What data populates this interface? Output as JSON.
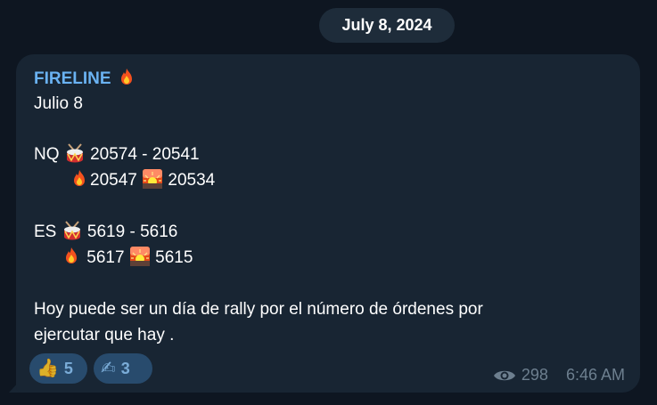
{
  "date_label": "July 8, 2024",
  "message": {
    "sender": "FIRELINE",
    "lines": {
      "date": "Julio 8",
      "nq_label": "NQ",
      "nq_range": "20574 - 20541",
      "nq_fire": "20547",
      "nq_sunrise": "20534",
      "es_label": "ES",
      "es_range": "5619 - 5616",
      "es_fire": "5617",
      "es_sunrise": "5615",
      "body_1": "Hoy puede ser un día de rally por el número de órdenes por",
      "body_2": "ejercutar que hay ."
    },
    "icons": {
      "sender": "fire-icon",
      "drum": "drum-icon",
      "fire": "fire-icon",
      "sunrise": "sunrise-icon"
    }
  },
  "reactions": [
    {
      "emoji": "👍",
      "icon": "thumbs-up-icon",
      "count": "5"
    },
    {
      "emoji": "✍",
      "icon": "writing-hand-icon",
      "count": "3"
    }
  ],
  "meta": {
    "views": "298",
    "time": "6:46 AM"
  },
  "colors": {
    "background": "#0e1621",
    "bubble": "#182533",
    "sender": "#6ab2f2",
    "reaction_bg": "#2b5278"
  }
}
